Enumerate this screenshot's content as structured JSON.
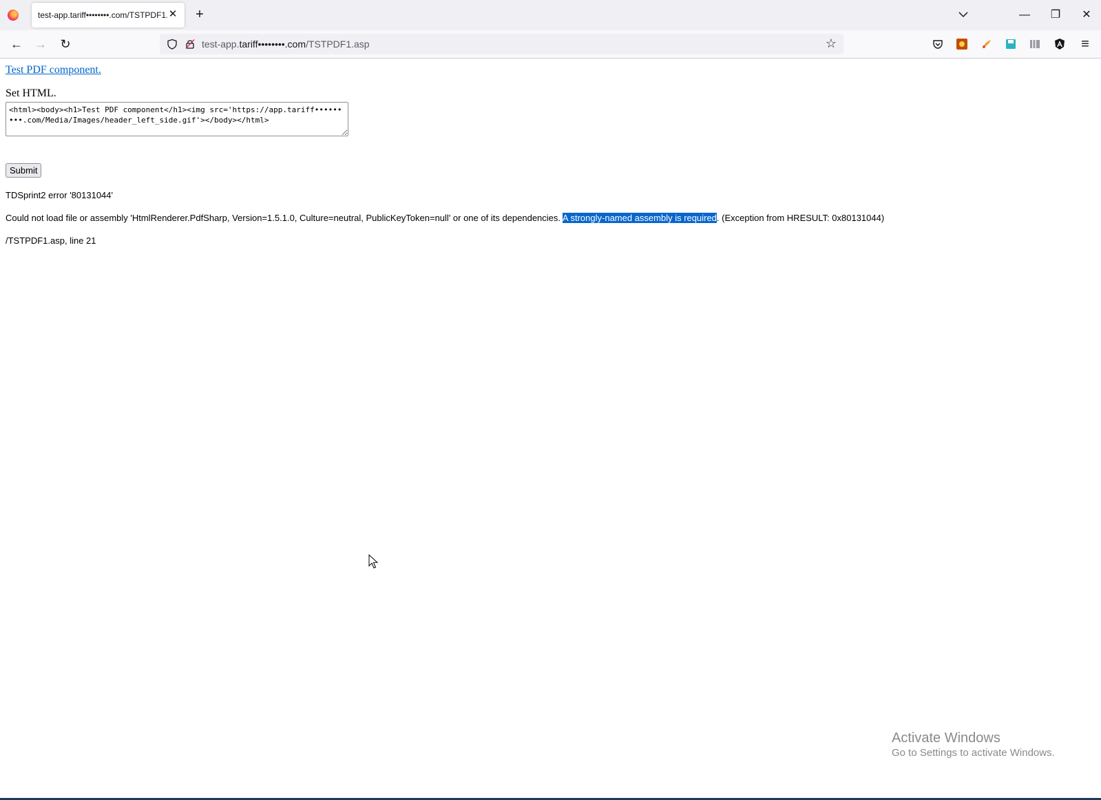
{
  "browser": {
    "tab": {
      "title": "test-app.tariff••••••••.com/TSTPDF1.asp",
      "close_glyph": "✕"
    },
    "new_tab_glyph": "+",
    "window": {
      "minimize_glyph": "—",
      "restore_glyph": "❐",
      "close_glyph": "✕"
    },
    "nav": {
      "back_glyph": "←",
      "forward_glyph": "→",
      "reload_glyph": "↻"
    },
    "url": {
      "host_prefix": "test-app.",
      "host_domain": "tariff••••••••.com",
      "path": "/TSTPDF1.asp"
    },
    "bookmark_glyph": "☆",
    "menu_glyph": "≡",
    "icons": [
      "firefox-logo-icon",
      "shield-icon",
      "insecure-lock-icon",
      "star-icon",
      "pocket-icon",
      "extension-sun-icon",
      "extension-paint-icon",
      "save-icon",
      "library-icon",
      "angular-icon",
      "menu-icon"
    ],
    "colors": {
      "highlight": "#0a66cc",
      "link": "#0066cc",
      "tabstrip": "#f0f0f4"
    }
  },
  "page": {
    "link_text": "Test PDF component.",
    "set_html_label": "Set HTML.",
    "textarea_value": "<html><body><h1>Test PDF component</h1><img src='https://app.tariff•••••••••.com/Media/Images/header_left_side.gif'></body></html>",
    "submit_label": "Submit",
    "error": {
      "title": "TDSprint2 error '80131044'",
      "message_before": "Could not load file or assembly 'HtmlRenderer.PdfSharp, Version=1.5.1.0, Culture=neutral, PublicKeyToken=null' or one of its dependencies. ",
      "message_highlight": "A strongly-named assembly is required",
      "message_after": ". (Exception from HRESULT: 0x80131044)",
      "location": "/TSTPDF1.asp, line 21"
    }
  },
  "watermark": {
    "title": "Activate Windows",
    "subtitle": "Go to Settings to activate Windows."
  }
}
